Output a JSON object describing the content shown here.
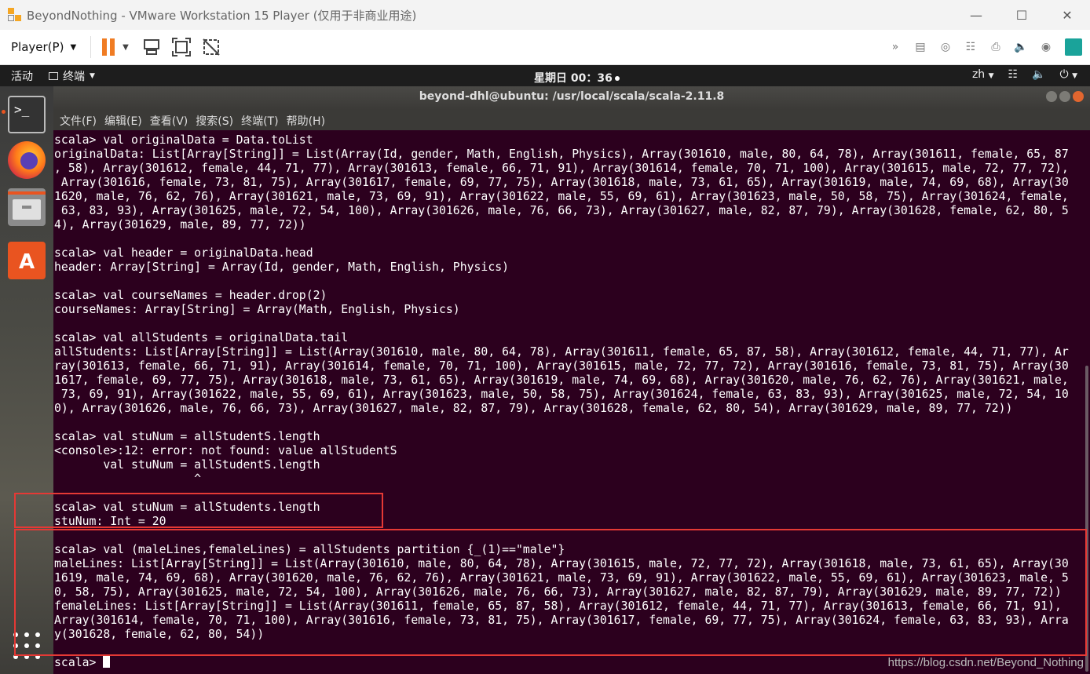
{
  "vmware": {
    "title": "BeyondNothing - VMware Workstation 15 Player (仅用于非商业用途)",
    "player_menu": "Player(P)"
  },
  "ubuntu": {
    "activities": "活动",
    "app_name": "终端",
    "clock": "星期日 00：36",
    "lang": "zh"
  },
  "terminal": {
    "title": "beyond-dhl@ubuntu: /usr/local/scala/scala-2.11.8",
    "menu": [
      "文件(F)",
      "编辑(E)",
      "查看(V)",
      "搜索(S)",
      "终端(T)",
      "帮助(H)"
    ],
    "lines": [
      "scala> val originalData = Data.toList",
      "originalData: List[Array[String]] = List(Array(Id, gender, Math, English, Physics), Array(301610, male, 80, 64, 78), Array(301611, female, 65, 87",
      ", 58), Array(301612, female, 44, 71, 77), Array(301613, female, 66, 71, 91), Array(301614, female, 70, 71, 100), Array(301615, male, 72, 77, 72),",
      " Array(301616, female, 73, 81, 75), Array(301617, female, 69, 77, 75), Array(301618, male, 73, 61, 65), Array(301619, male, 74, 69, 68), Array(30",
      "1620, male, 76, 62, 76), Array(301621, male, 73, 69, 91), Array(301622, male, 55, 69, 61), Array(301623, male, 50, 58, 75), Array(301624, female,",
      " 63, 83, 93), Array(301625, male, 72, 54, 100), Array(301626, male, 76, 66, 73), Array(301627, male, 82, 87, 79), Array(301628, female, 62, 80, 5",
      "4), Array(301629, male, 89, 77, 72))",
      "",
      "scala> val header = originalData.head",
      "header: Array[String] = Array(Id, gender, Math, English, Physics)",
      "",
      "scala> val courseNames = header.drop(2)",
      "courseNames: Array[String] = Array(Math, English, Physics)",
      "",
      "scala> val allStudents = originalData.tail",
      "allStudents: List[Array[String]] = List(Array(301610, male, 80, 64, 78), Array(301611, female, 65, 87, 58), Array(301612, female, 44, 71, 77), Ar",
      "ray(301613, female, 66, 71, 91), Array(301614, female, 70, 71, 100), Array(301615, male, 72, 77, 72), Array(301616, female, 73, 81, 75), Array(30",
      "1617, female, 69, 77, 75), Array(301618, male, 73, 61, 65), Array(301619, male, 74, 69, 68), Array(301620, male, 76, 62, 76), Array(301621, male,",
      " 73, 69, 91), Array(301622, male, 55, 69, 61), Array(301623, male, 50, 58, 75), Array(301624, female, 63, 83, 93), Array(301625, male, 72, 54, 10",
      "0), Array(301626, male, 76, 66, 73), Array(301627, male, 82, 87, 79), Array(301628, female, 62, 80, 54), Array(301629, male, 89, 77, 72))",
      "",
      "scala> val stuNum = allStudentS.length",
      "<console>:12: error: not found: value allStudentS",
      "       val stuNum = allStudentS.length",
      "                    ^",
      "",
      "scala> val stuNum = allStudents.length",
      "stuNum: Int = 20",
      "",
      "scala> val (maleLines,femaleLines) = allStudents partition {_(1)==\"male\"}",
      "maleLines: List[Array[String]] = List(Array(301610, male, 80, 64, 78), Array(301615, male, 72, 77, 72), Array(301618, male, 73, 61, 65), Array(30",
      "1619, male, 74, 69, 68), Array(301620, male, 76, 62, 76), Array(301621, male, 73, 69, 91), Array(301622, male, 55, 69, 61), Array(301623, male, 5",
      "0, 58, 75), Array(301625, male, 72, 54, 100), Array(301626, male, 76, 66, 73), Array(301627, male, 82, 87, 79), Array(301629, male, 89, 77, 72))",
      "femaleLines: List[Array[String]] = List(Array(301611, female, 65, 87, 58), Array(301612, female, 44, 71, 77), Array(301613, female, 66, 71, 91),",
      "Array(301614, female, 70, 71, 100), Array(301616, female, 73, 81, 75), Array(301617, female, 69, 77, 75), Array(301624, female, 63, 83, 93), Arra",
      "y(301628, female, 62, 80, 54))",
      ""
    ],
    "prompt": "scala> "
  },
  "watermark": "https://blog.csdn.net/Beyond_Nothing",
  "colors": {
    "terminal_bg": "#2c001e",
    "highlight": "#e53935",
    "ubuntu_orange": "#e95420"
  }
}
